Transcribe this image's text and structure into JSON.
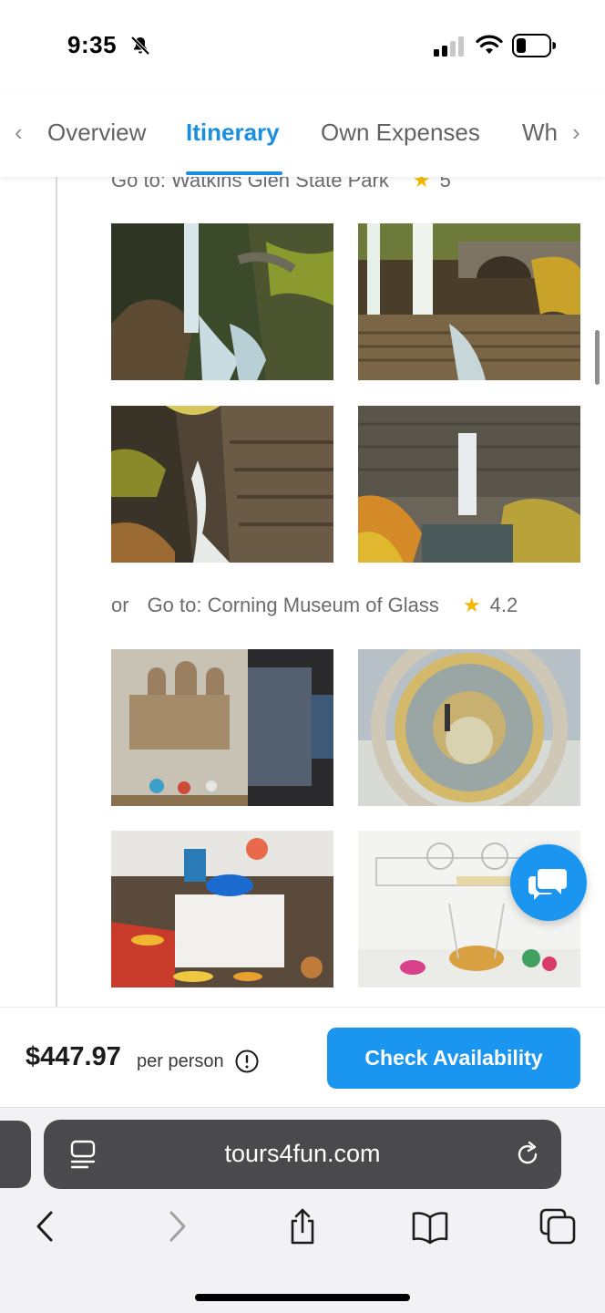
{
  "status_bar": {
    "time": "9:35",
    "icons": [
      "bell-slash-icon",
      "cellular-signal-icon",
      "wifi-icon",
      "battery-icon"
    ]
  },
  "tabs": {
    "items": [
      "Overview",
      "Itinerary",
      "Own Expenses",
      "Wh"
    ],
    "active": "Itinerary"
  },
  "itinerary": {
    "stop1": {
      "label": "Go to: Watkins Glen State Park",
      "rating": "5"
    },
    "stop2": {
      "prefix": "or",
      "label": "Go to: Corning Museum of Glass",
      "rating": "4.2"
    }
  },
  "booking": {
    "price": "$447.97",
    "per_person": "per person",
    "cta": "Check Availability"
  },
  "browser": {
    "url": "tours4fun.com"
  },
  "colors": {
    "accent": "#1a96f0",
    "active_tab": "#1a8fe0",
    "star": "#f5b800"
  }
}
